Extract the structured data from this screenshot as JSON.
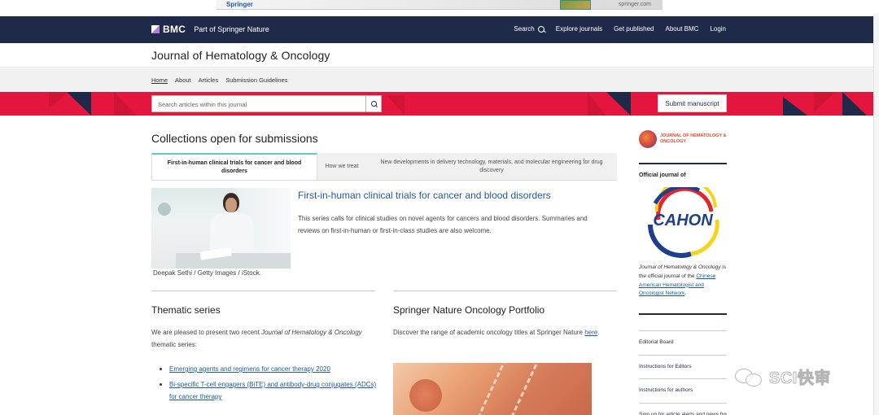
{
  "ad": {
    "logo": "Springer",
    "url": "springer.com"
  },
  "topnav": {
    "brand": "BMC",
    "brand_sub": "Part of Springer Nature",
    "search": "Search",
    "explore": "Explore journals",
    "get_published": "Get published",
    "about": "About BMC",
    "login": "Login"
  },
  "journal": {
    "title": "Journal of Hematology & Oncology"
  },
  "subnav": {
    "home": "Home",
    "about": "About",
    "articles": "Articles",
    "guidelines": "Submission Guidelines"
  },
  "search": {
    "placeholder": "Search articles within this journal",
    "submit": "Submit manuscript"
  },
  "collections": {
    "title": "Collections open for submissions",
    "tabs": [
      {
        "label": "First-in-human clinical trials for cancer and blood disorders"
      },
      {
        "label": "How we treat"
      },
      {
        "label": "New developments in delivery technology, materials, and molecular engineering for drug discovery"
      }
    ],
    "feature": {
      "caption": "Deepak Sethi / Getty Images / iStock.",
      "title": "First-in-human clinical trials for cancer and blood disorders",
      "description": "This series calls for clinical studies on novel agents for cancers and blood disorders. Summaries and reviews on first-in-human or first-in-class studies are also welcome."
    }
  },
  "thematic": {
    "title": "Thematic series",
    "desc_pre": "We are pleased to present two recent ",
    "desc_journal": "Journal of Hematology & Oncology",
    "desc_post": " thematic series:",
    "items": [
      "Emerging agents and regimens for cancer therapy 2020",
      "Bi-specific T-cell engagers (BiTE) and antibody-drug conjugates (ADCs) for cancer therapy"
    ]
  },
  "portfolio": {
    "title": "Springer Nature Oncology Portfolio",
    "desc_pre": "Discover the range of academic oncology titles at Springer Nature ",
    "desc_link": "here",
    "desc_post": "."
  },
  "sidebar": {
    "logo_text": "JOURNAL OF HEMATOLOGY & ONCOLOGY",
    "official_label": "Official journal of",
    "cahon_text": "CAHON",
    "desc_journal": "Journal of Hematology & Oncology",
    "desc_mid": " is the official journal of the ",
    "desc_link": "Chinese American Hematologist and Oncologist Network",
    "desc_end": ".",
    "menu": [
      "Editorial Board",
      "Instructions for Editors",
      "Instructions for authors",
      "Sign up for article alerts and news from this journal"
    ]
  },
  "watermark": {
    "text": "SCI快审"
  },
  "colors": {
    "navy": "#1f2a48",
    "accent_red": "#e5163d",
    "link_blue": "#1d5a9a"
  }
}
